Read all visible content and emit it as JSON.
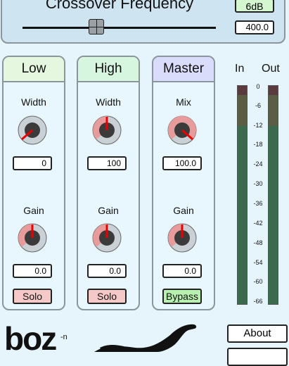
{
  "crossover": {
    "title": "Crossover Frequency",
    "slope": "6dB",
    "frequency": "400.0"
  },
  "bands": [
    {
      "name": "Low",
      "header_color": "#e6f7df",
      "knob1_label": "Width",
      "knob1_value": "0",
      "knob2_label": "Gain",
      "knob2_value": "0.0",
      "button": "Solo",
      "button_color": "#f6c9c9"
    },
    {
      "name": "High",
      "header_color": "#d6f6df",
      "knob1_label": "Width",
      "knob1_value": "100",
      "knob2_label": "Gain",
      "knob2_value": "0.0",
      "button": "Solo",
      "button_color": "#f6c9c9"
    },
    {
      "name": "Master",
      "header_color": "#d9dcfb",
      "knob1_label": "Mix",
      "knob1_value": "100.0",
      "knob2_label": "Gain",
      "knob2_value": "0.0",
      "button": "Bypass",
      "button_color": "#b7f0b0"
    }
  ],
  "meters": {
    "in_label": "In",
    "out_label": "Out",
    "scale": [
      "0",
      "-6",
      "-12",
      "-18",
      "-24",
      "-30",
      "-36",
      "-42",
      "-48",
      "-54",
      "-60",
      "-66"
    ]
  },
  "footer": {
    "logo": "boz",
    "logo_sup": "-n",
    "about": "About"
  }
}
